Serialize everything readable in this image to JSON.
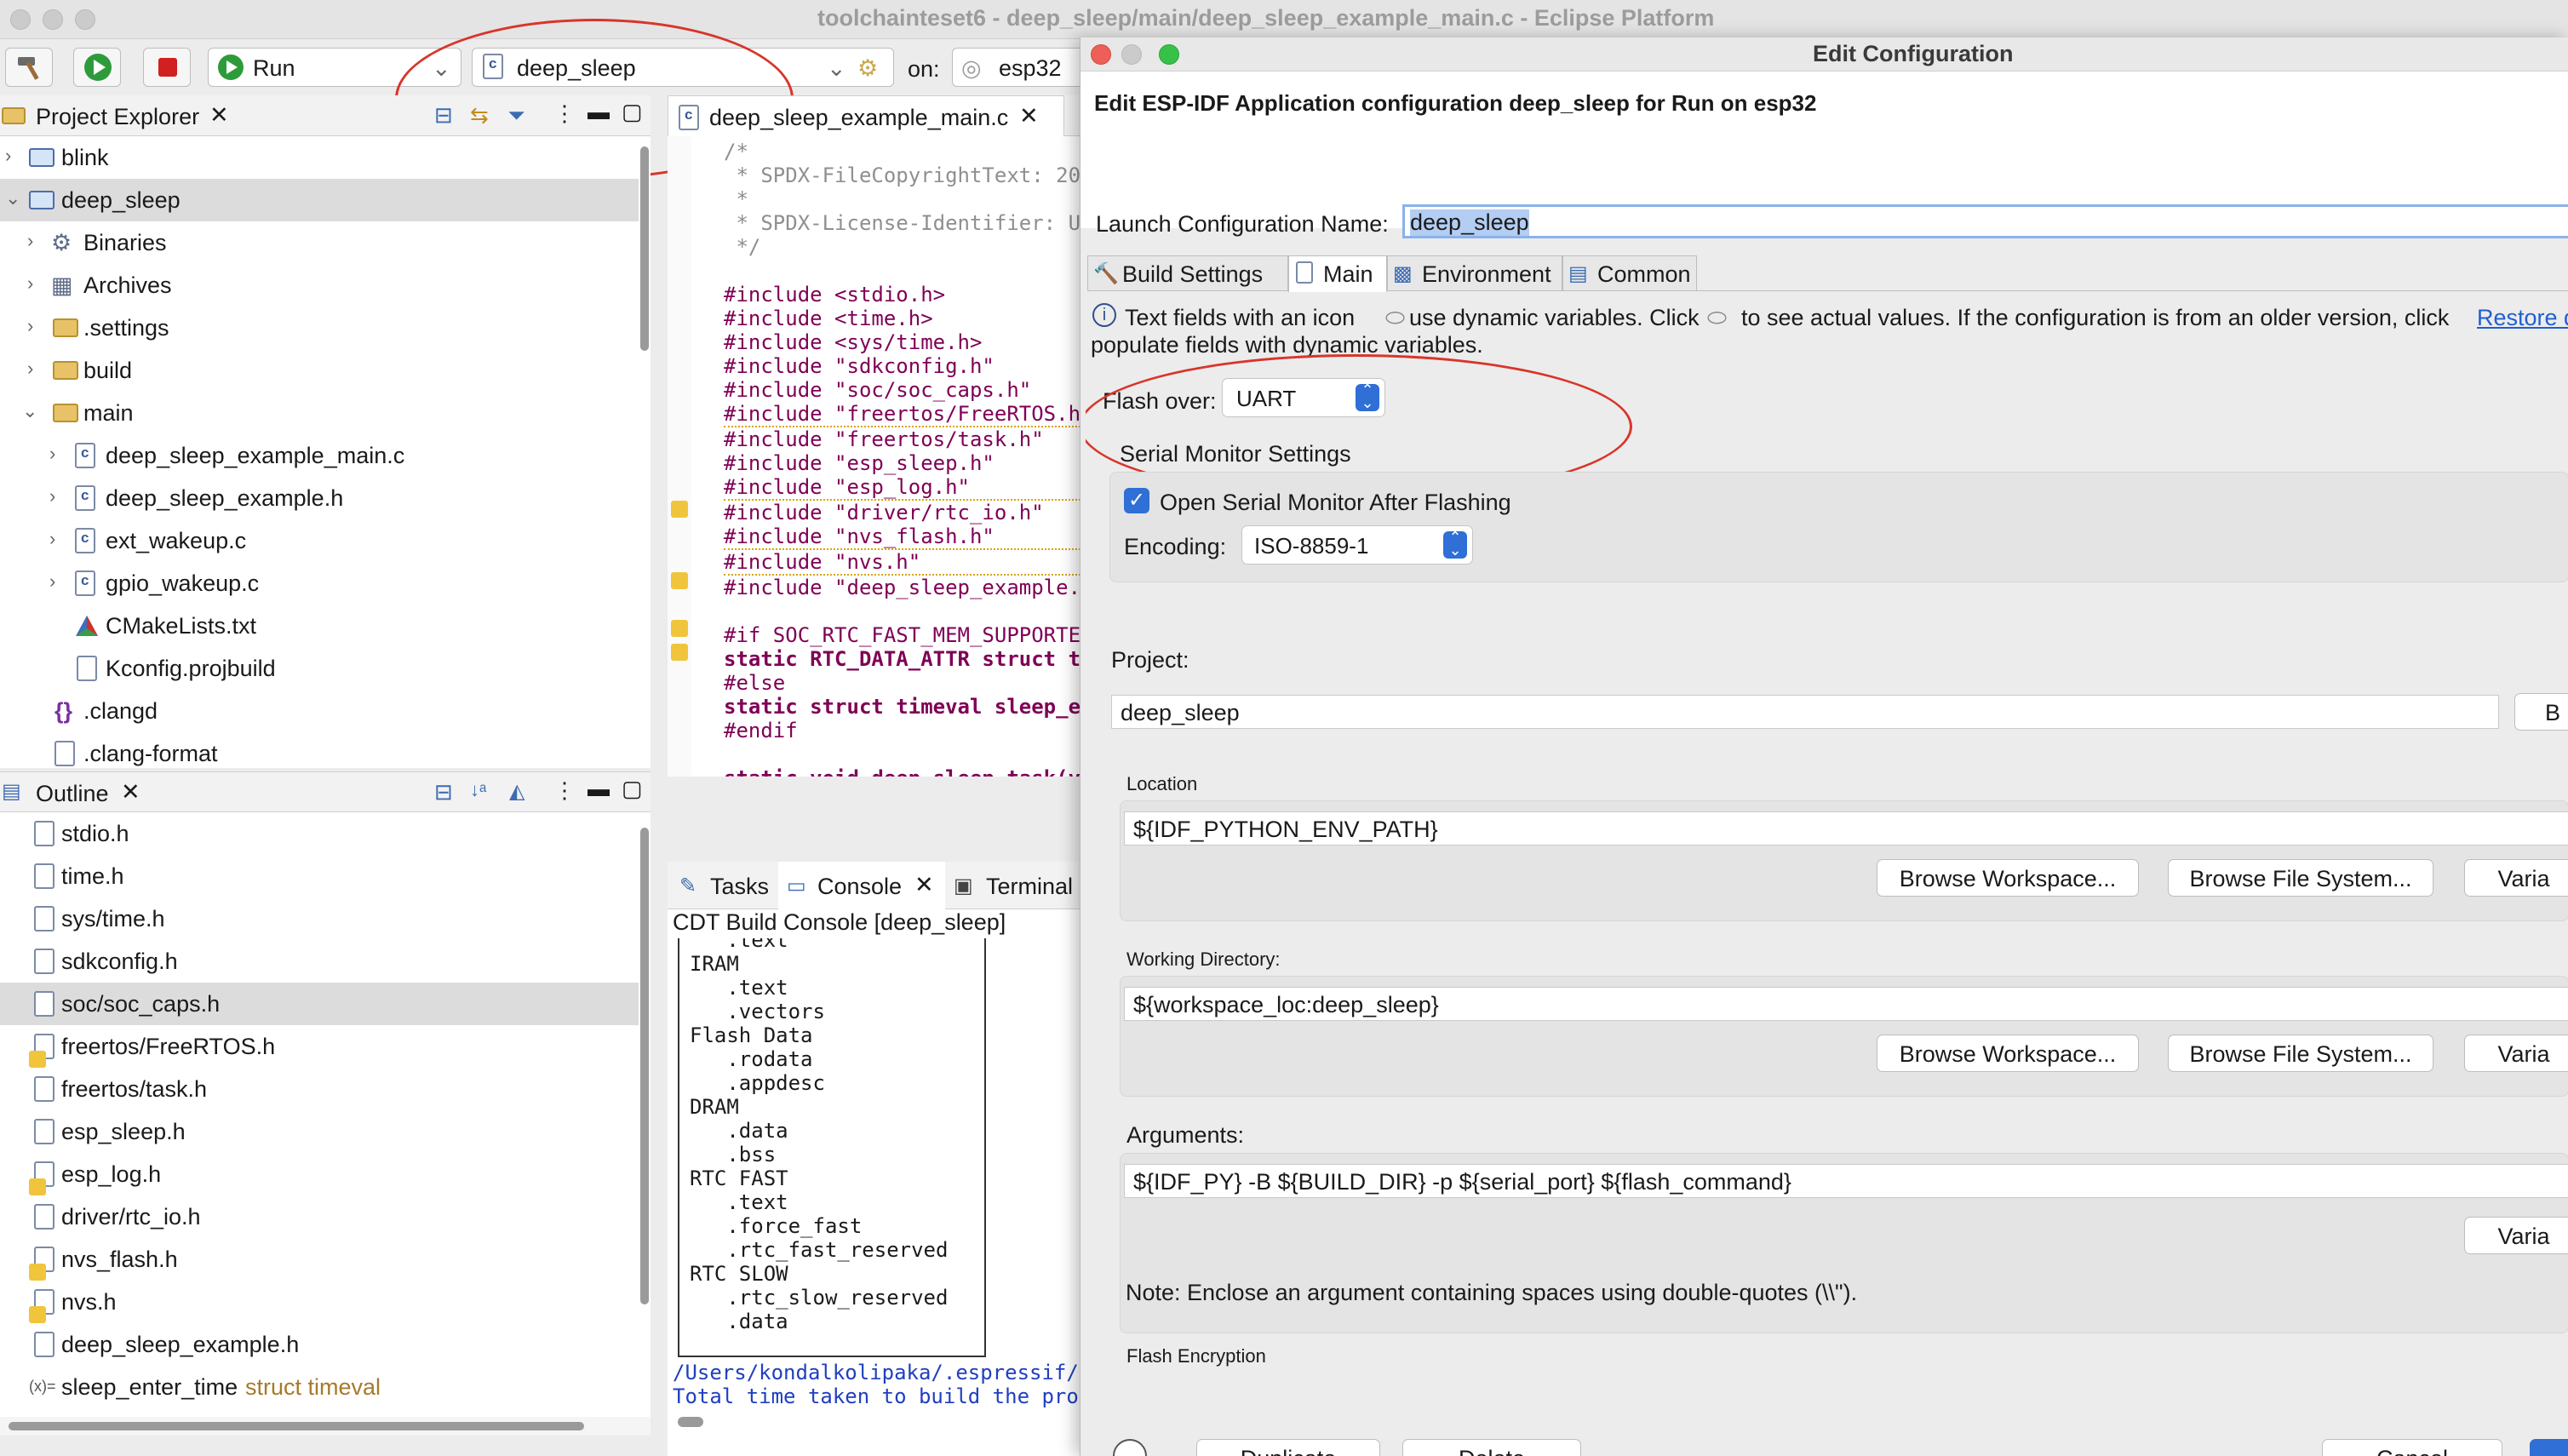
{
  "window": {
    "title": "toolchainteset6 - deep_sleep/main/deep_sleep_example_main.c - Eclipse Platform"
  },
  "toolbar": {
    "mode": "Run",
    "launch_config": "deep_sleep",
    "on_label": "on:",
    "target": "esp32"
  },
  "project_explorer": {
    "title": "Project Explorer",
    "items": [
      {
        "label": "blink"
      },
      {
        "label": "deep_sleep"
      },
      {
        "label": "Binaries"
      },
      {
        "label": "Archives"
      },
      {
        "label": ".settings"
      },
      {
        "label": "build"
      },
      {
        "label": "main"
      },
      {
        "label": "deep_sleep_example_main.c"
      },
      {
        "label": "deep_sleep_example.h"
      },
      {
        "label": "ext_wakeup.c"
      },
      {
        "label": "gpio_wakeup.c"
      },
      {
        "label": "CMakeLists.txt"
      },
      {
        "label": "Kconfig.projbuild"
      },
      {
        "label": ".clangd"
      },
      {
        "label": ".clang-format"
      }
    ]
  },
  "outline": {
    "title": "Outline",
    "items": [
      {
        "label": "stdio.h"
      },
      {
        "label": "time.h"
      },
      {
        "label": "sys/time.h"
      },
      {
        "label": "sdkconfig.h"
      },
      {
        "label": "soc/soc_caps.h"
      },
      {
        "label": "freertos/FreeRTOS.h"
      },
      {
        "label": "freertos/task.h"
      },
      {
        "label": "esp_sleep.h"
      },
      {
        "label": "esp_log.h"
      },
      {
        "label": "driver/rtc_io.h"
      },
      {
        "label": "nvs_flash.h"
      },
      {
        "label": "nvs.h"
      },
      {
        "label": "deep_sleep_example.h"
      }
    ],
    "last_var": {
      "prefix": "(x)=",
      "name": "sleep_enter_time",
      "type": "struct timeval"
    }
  },
  "editor": {
    "tab": "deep_sleep_example_main.c",
    "lines": [
      "/*",
      " * SPDX-FileCopyrightText: 20",
      " *",
      " * SPDX-License-Identifier: U",
      " */",
      "",
      "#include <stdio.h>",
      "#include <time.h>",
      "#include <sys/time.h>",
      "#include \"sdkconfig.h\"",
      "#include \"soc/soc_caps.h\"",
      "#include \"freertos/FreeRTOS.h",
      "#include \"freertos/task.h\"",
      "#include \"esp_sleep.h\"",
      "#include \"esp_log.h\"",
      "#include \"driver/rtc_io.h\"",
      "#include \"nvs_flash.h\"",
      "#include \"nvs.h\"",
      "#include \"deep_sleep_example.",
      "",
      "#if SOC_RTC_FAST_MEM_SUPPORTE",
      "static RTC_DATA_ATTR struct t",
      "#else",
      "static struct timeval sleep_e",
      "#endif",
      "",
      "static void deep_sleep_task(v",
      "{",
      "    /**"
    ]
  },
  "bottom_tabs": {
    "tasks": "Tasks",
    "console": "Console",
    "terminal": "Terminal"
  },
  "console": {
    "title": "CDT Build Console [deep_sleep]",
    "lines": [
      "   .text",
      "IRAM",
      "   .text",
      "   .vectors",
      "Flash Data",
      "   .rodata",
      "   .appdesc",
      "DRAM",
      "   .data",
      "   .bss",
      "RTC FAST",
      "   .text",
      "   .force_fast",
      "   .rtc_fast_reserved",
      "RTC SLOW",
      "   .rtc_slow_reserved",
      "   .data"
    ],
    "path_line": "/Users/kondalkolipaka/.espressif/",
    "total_line": "Total time taken to build the pro"
  },
  "dialog": {
    "title": "Edit Configuration",
    "heading": "Edit ESP-IDF Application configuration deep_sleep for Run on esp32",
    "name_label": "Launch Configuration Name:",
    "name_value": "deep_sleep",
    "tabs": [
      "Build Settings",
      "Main",
      "Environment",
      "Common"
    ],
    "info_text_1": "Text fields with an icon",
    "info_text_2": "use dynamic variables. Click",
    "info_text_3": "to see actual values. If the configuration is from an older version, click",
    "info_link": "Restore de",
    "info_text_4": "populate fields with dynamic variables.",
    "flash_over_label": "Flash over:",
    "flash_over_value": "UART",
    "serial_monitor_title": "Serial Monitor Settings",
    "open_monitor_label": "Open Serial Monitor After Flashing",
    "encoding_label": "Encoding:",
    "encoding_value": "ISO-8859-1",
    "project_label": "Project:",
    "project_value": "deep_sleep",
    "project_browse": "B",
    "location_label": "Location",
    "location_value": "${IDF_PYTHON_ENV_PATH}",
    "browse_workspace": "Browse Workspace...",
    "browse_fs": "Browse File System...",
    "variables": "Varia",
    "working_dir_label": "Working Directory:",
    "working_dir_value": "${workspace_loc:deep_sleep}",
    "arguments_label": "Arguments:",
    "arguments_value": "${IDF_PY} -B ${BUILD_DIR} -p ${serial_port} ${flash_command}",
    "note": "Note: Enclose an argument containing spaces using double-quotes (\\\\\").",
    "flash_encryption_label": "Flash Encryption",
    "duplicate": "Duplicate",
    "delete": "Delete",
    "cancel": "Cancel"
  },
  "colors": {
    "accent": "#2f6fd6",
    "annotation": "#d8352a",
    "selection": "#dcdcdc"
  }
}
